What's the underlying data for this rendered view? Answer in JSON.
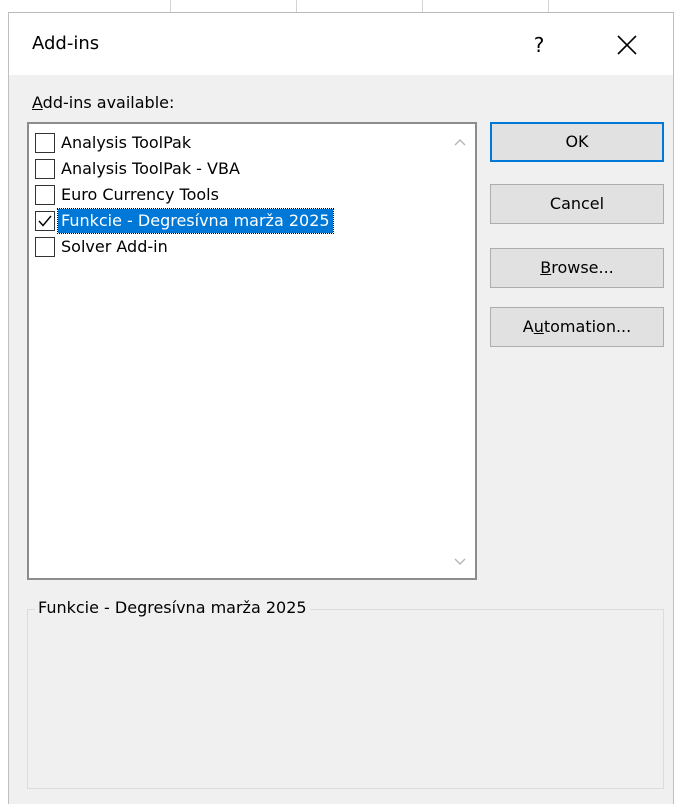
{
  "dialog": {
    "title": "Add-ins",
    "help_label": "?"
  },
  "list": {
    "label_prefix": "A",
    "label_rest": "dd-ins available:",
    "items": [
      {
        "label": "Analysis ToolPak",
        "checked": false
      },
      {
        "label": "Analysis ToolPak - VBA",
        "checked": false
      },
      {
        "label": "Euro Currency Tools",
        "checked": false
      },
      {
        "label": "Funkcie - Degresívna marža 2025",
        "checked": true,
        "selected": true
      },
      {
        "label": "Solver Add-in",
        "checked": false
      }
    ]
  },
  "buttons": {
    "ok": "OK",
    "cancel": "Cancel",
    "browse_prefix": "B",
    "browse_rest": "rowse...",
    "automation_prefix": "A",
    "automation_mnemonic": "u",
    "automation_rest": "tomation..."
  },
  "description": {
    "title": "Funkcie - Degresívna marža 2025"
  },
  "colors": {
    "selection": "#0078d7",
    "dialog_bg": "#f0f0f0"
  }
}
